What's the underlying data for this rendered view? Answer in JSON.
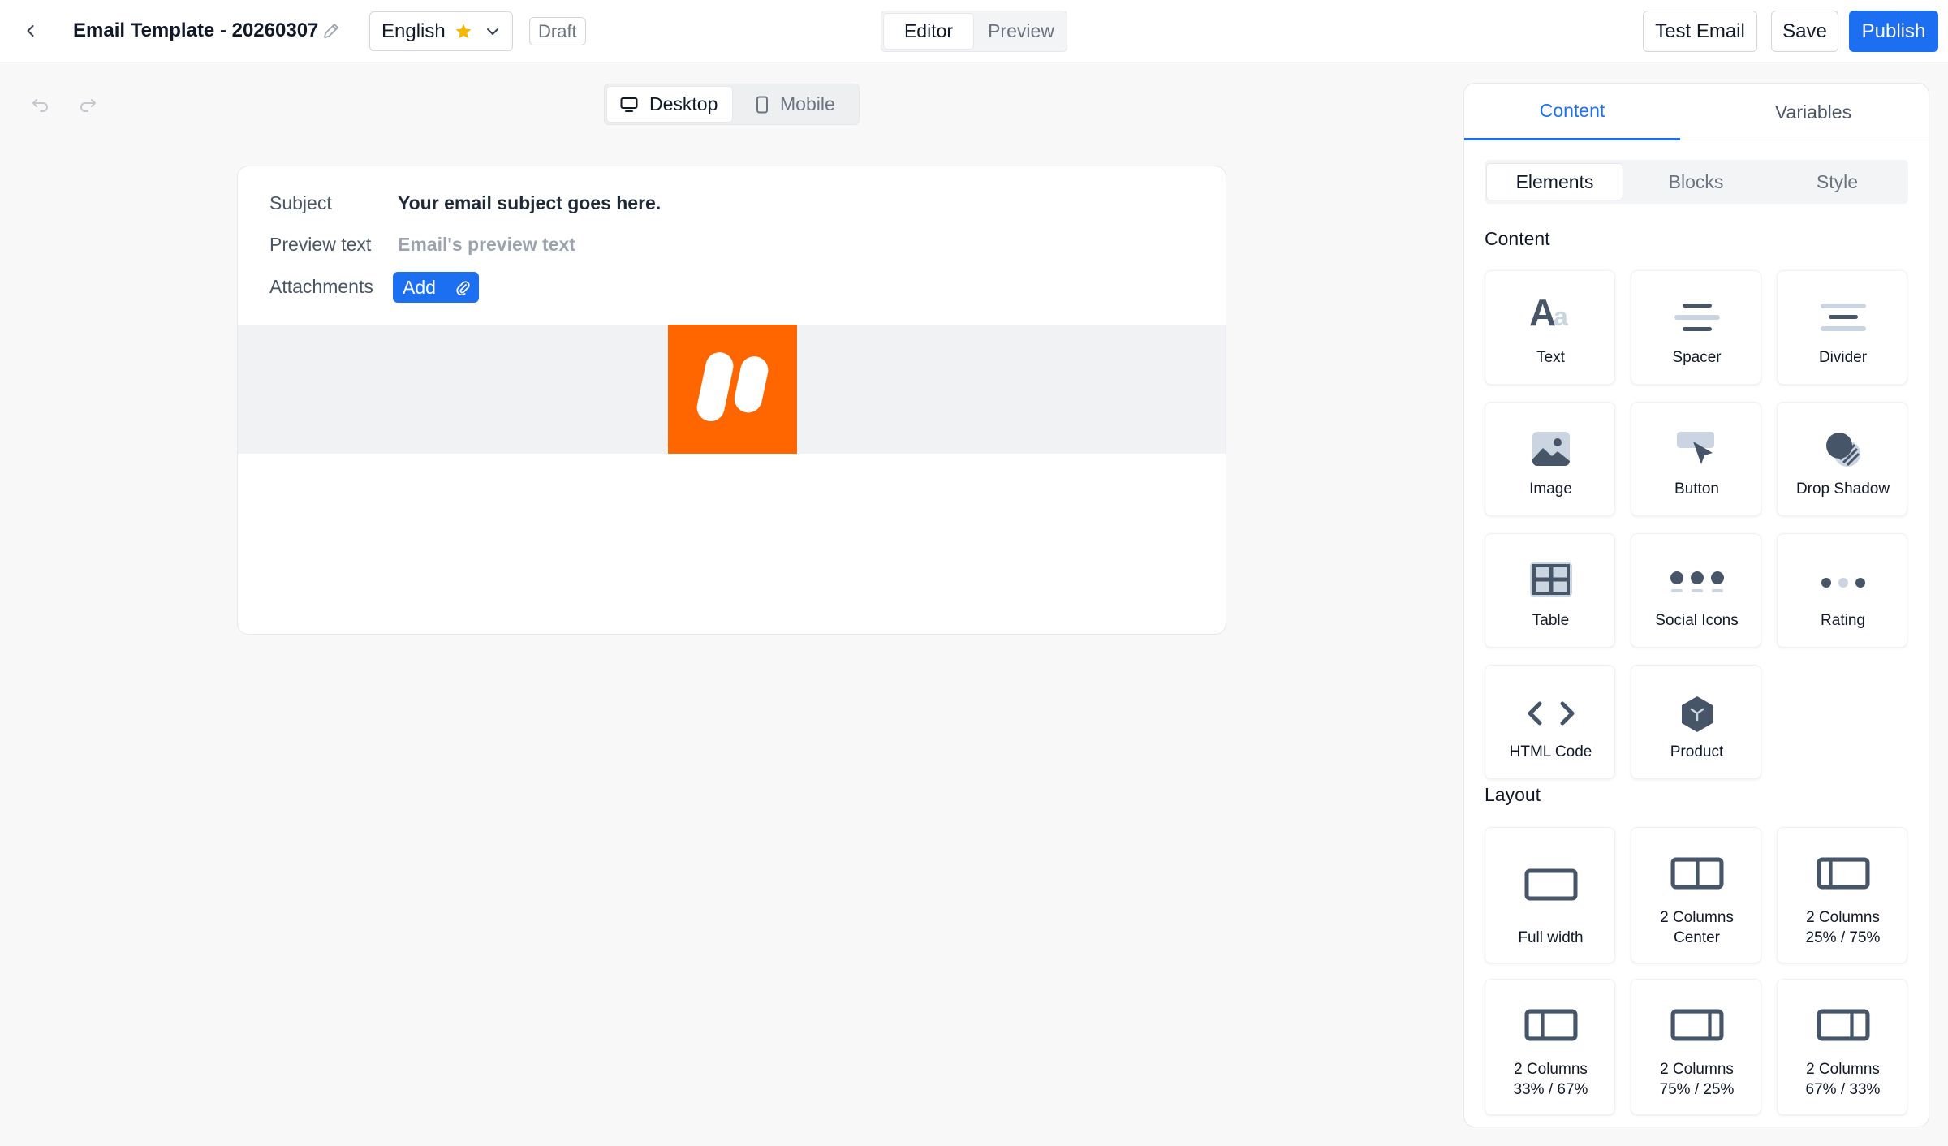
{
  "header": {
    "template_title": "Email Template - 20260307",
    "language": "English",
    "status": "Draft",
    "mode_tabs": [
      "Editor",
      "Preview"
    ],
    "buttons": {
      "test_email": "Test Email",
      "save": "Save",
      "publish": "Publish"
    }
  },
  "canvas": {
    "device_tabs": [
      "Desktop",
      "Mobile"
    ],
    "email": {
      "subject_label": "Subject",
      "subject_value": "Your email subject goes here.",
      "preview_label": "Preview text",
      "preview_placeholder": "Email's preview text",
      "attachments_label": "Attachments",
      "add_label": "Add"
    }
  },
  "panel": {
    "tabs": [
      "Content",
      "Variables"
    ],
    "subtabs": [
      "Elements",
      "Blocks",
      "Style"
    ],
    "content_heading": "Content",
    "content_items": [
      {
        "label": "Text",
        "icon": "text-icon"
      },
      {
        "label": "Spacer",
        "icon": "spacer-icon"
      },
      {
        "label": "Divider",
        "icon": "divider-icon"
      },
      {
        "label": "Image",
        "icon": "image-icon"
      },
      {
        "label": "Button",
        "icon": "button-icon"
      },
      {
        "label": "Drop Shadow",
        "icon": "drop-shadow-icon"
      },
      {
        "label": "Table",
        "icon": "table-icon"
      },
      {
        "label": "Social Icons",
        "icon": "social-icons-icon"
      },
      {
        "label": "Rating",
        "icon": "rating-icon"
      },
      {
        "label": "HTML Code",
        "icon": "html-code-icon"
      },
      {
        "label": "Product",
        "icon": "product-icon"
      }
    ],
    "layout_heading": "Layout",
    "layout_items": [
      {
        "line1": "Full width",
        "line2": "",
        "icon": "full-width-icon"
      },
      {
        "line1": "2 Columns",
        "line2": "Center",
        "icon": "two-columns-center-icon"
      },
      {
        "line1": "2 Columns",
        "line2": "25% / 75%",
        "icon": "two-columns-25-75-icon"
      },
      {
        "line1": "2 Columns",
        "line2": "33% / 67%",
        "icon": "two-columns-33-67-icon"
      },
      {
        "line1": "2 Columns",
        "line2": "75% / 25%",
        "icon": "two-columns-75-25-icon"
      },
      {
        "line1": "2 Columns",
        "line2": "67% / 33%",
        "icon": "two-columns-67-33-icon"
      }
    ]
  },
  "colors": {
    "accent": "#1d6ff2",
    "brand_logo": "#ff6600",
    "icon_dark": "#475569",
    "icon_light": "#cbd5e1",
    "star": "#f5b800"
  }
}
